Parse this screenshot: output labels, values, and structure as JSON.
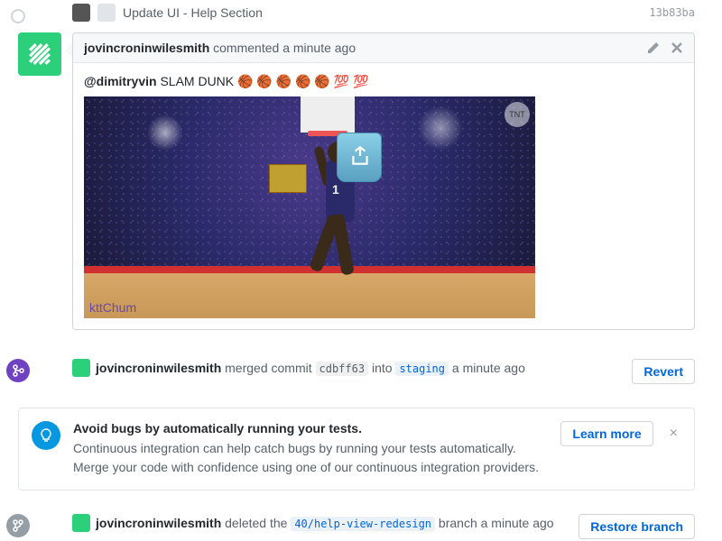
{
  "commit": {
    "title": "Update UI - Help Section",
    "sha": "13b83ba"
  },
  "comment": {
    "author": "jovincroninwilesmith",
    "action": " commented ",
    "time": "a minute ago",
    "mention": "@dimitryvin",
    "message": " SLAM DUNK 🏀 🏀 🏀 🏀 🏀 💯 💯",
    "watermark": "kttChum",
    "broadcast": "TNT",
    "jersey": "1"
  },
  "merge_event": {
    "actor": "jovincroninwilesmith",
    "pre": " merged commit ",
    "sha": "cdbff63",
    "mid": " into ",
    "target": "staging",
    "time": " a minute ago",
    "button": "Revert"
  },
  "ci": {
    "title": "Avoid bugs by automatically running your tests.",
    "desc": "Continuous integration can help catch bugs by running your tests automatically. Merge your code with confidence using one of our continuous integration providers.",
    "learn": "Learn more",
    "dismiss": "×"
  },
  "delete_event": {
    "actor": "jovincroninwilesmith",
    "pre": " deleted the ",
    "branch": "40/help-view-redesign",
    "post": " branch a minute ago",
    "button": "Restore branch"
  }
}
